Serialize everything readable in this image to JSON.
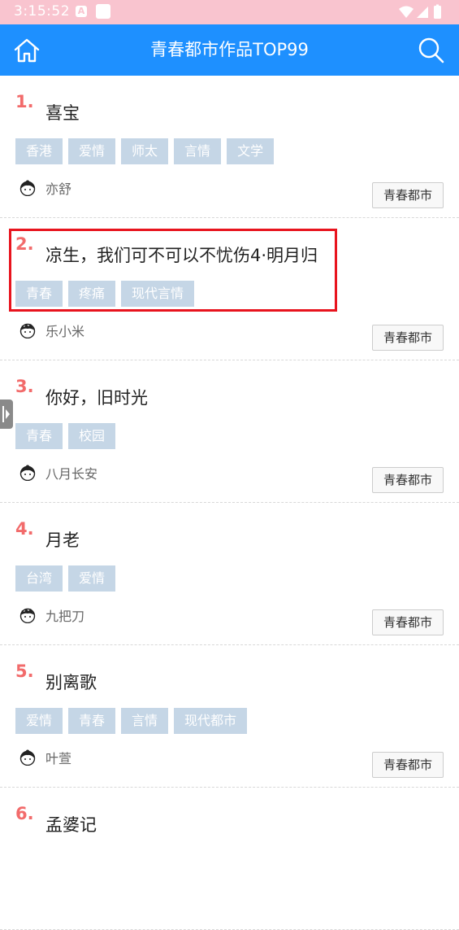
{
  "status_bar": {
    "time": "3:15:52",
    "notif_icon": "A"
  },
  "header": {
    "title": "青春都市作品TOP99"
  },
  "items": [
    {
      "rank": "1.",
      "title": "喜宝",
      "tags": [
        "香港",
        "爱情",
        "师太",
        "言情",
        "文学"
      ],
      "author": "亦舒",
      "category": "青春都市"
    },
    {
      "rank": "2.",
      "title": "凉生，我们可不可以不忧伤4·明月归",
      "tags": [
        "青春",
        "疼痛",
        "现代言情"
      ],
      "author": "乐小米",
      "category": "青春都市"
    },
    {
      "rank": "3.",
      "title": "你好，旧时光",
      "tags": [
        "青春",
        "校园"
      ],
      "author": "八月长安",
      "category": "青春都市"
    },
    {
      "rank": "4.",
      "title": "月老",
      "tags": [
        "台湾",
        "爱情"
      ],
      "author": "九把刀",
      "category": "青春都市"
    },
    {
      "rank": "5.",
      "title": "别离歌",
      "tags": [
        "爱情",
        "青春",
        "言情",
        "现代都市"
      ],
      "author": "叶萱",
      "category": "青春都市"
    },
    {
      "rank": "6.",
      "title": "孟婆记",
      "tags": [],
      "author": "",
      "category": ""
    }
  ],
  "colors": {
    "accent": "#1e90ff",
    "rank": "#f26b6b",
    "tag_bg": "#c5d6e6",
    "status_bar": "#f9c4cf",
    "highlight": "#e8141e"
  }
}
